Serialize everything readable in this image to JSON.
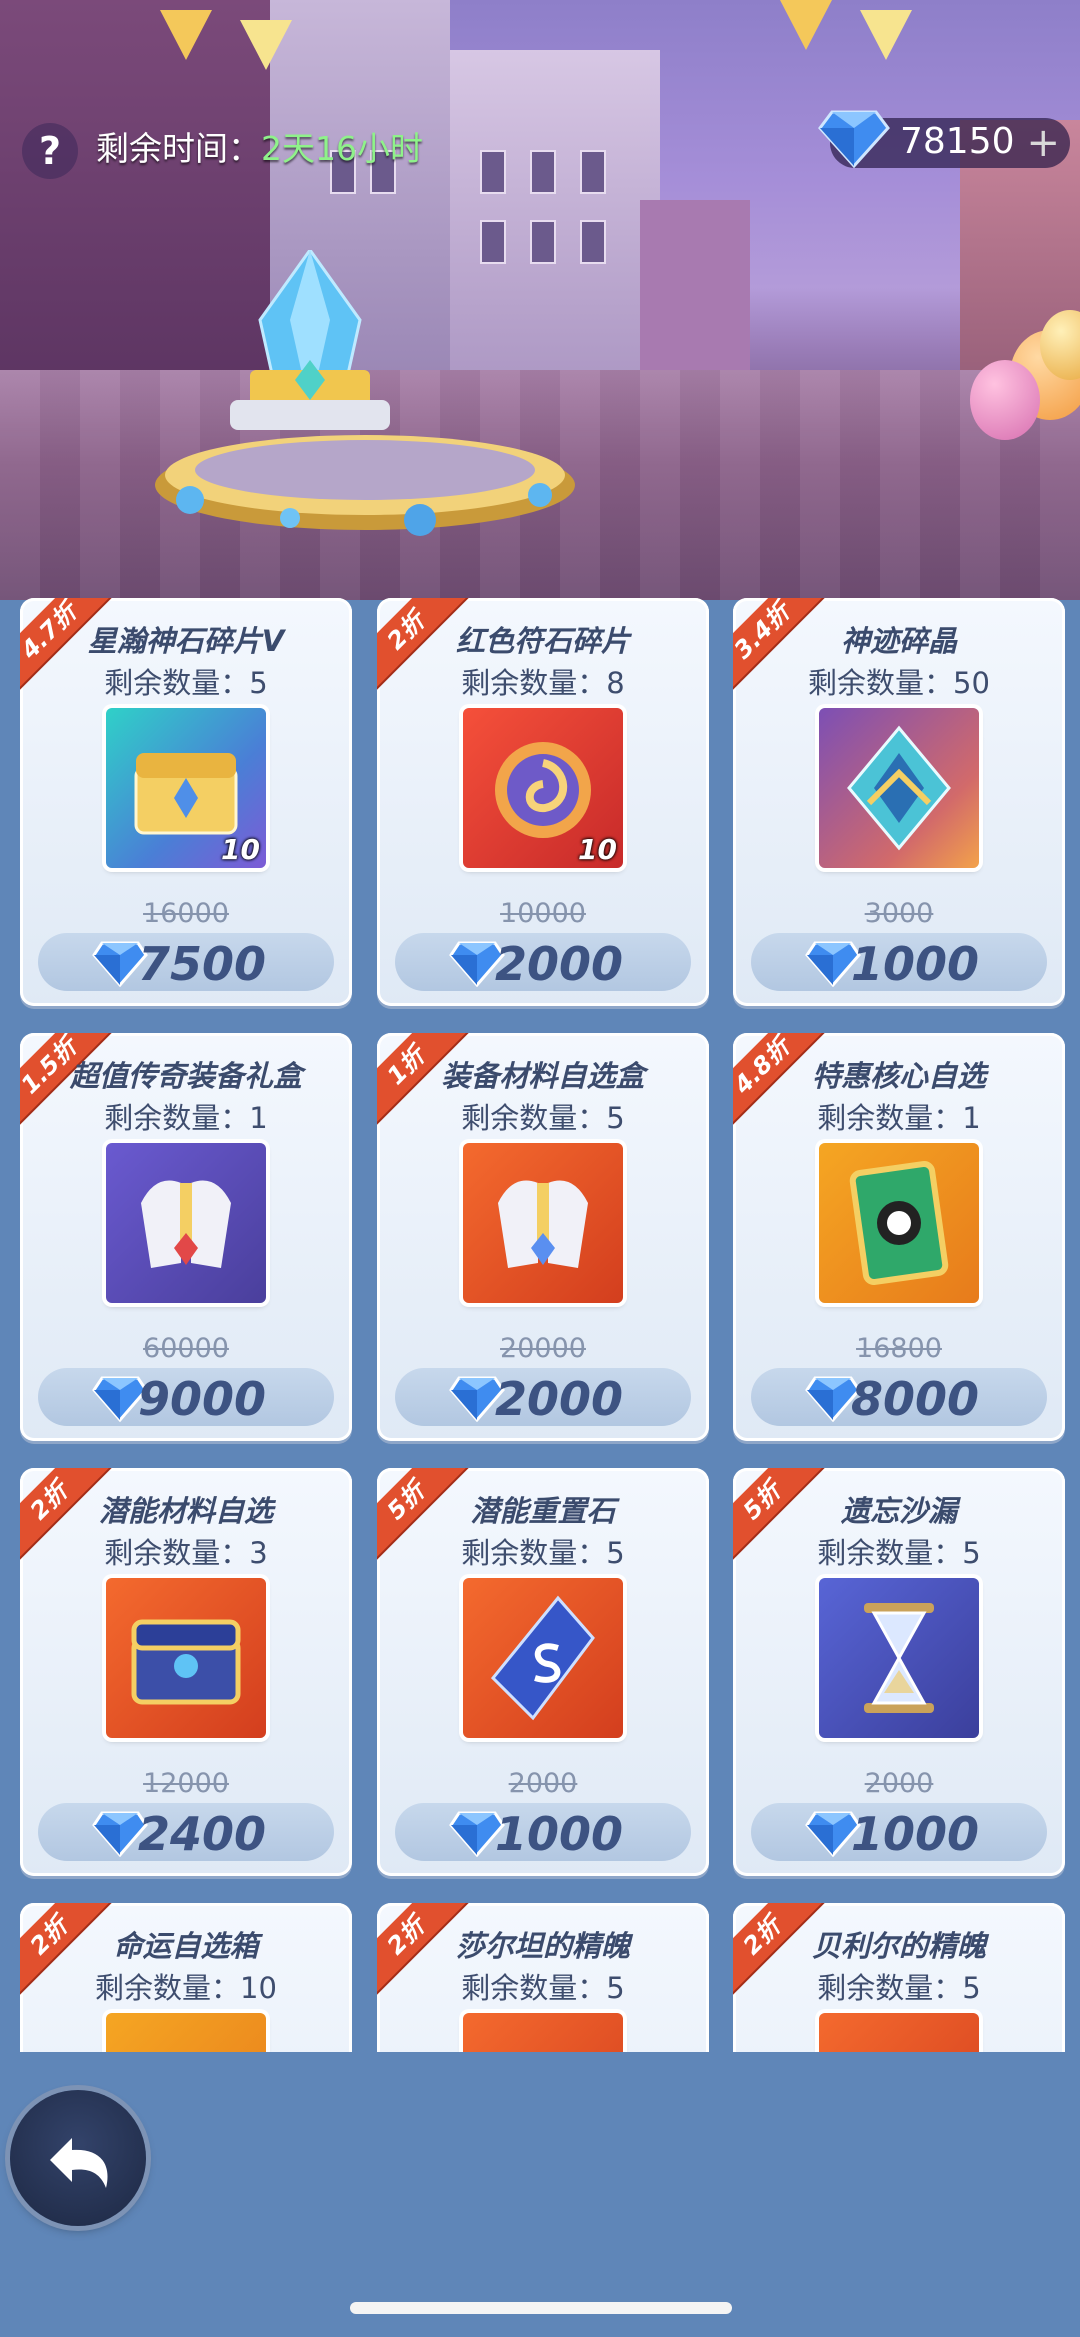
{
  "header": {
    "help_icon": "question-icon",
    "help_label": "?",
    "time_label": "剩余时间：",
    "time_value": "2天16小时",
    "currency_amount": "78150",
    "currency_icon": "diamond-icon",
    "add_icon": "plus-icon",
    "add_label": "+"
  },
  "colors": {
    "discount_tag": "#e1502e",
    "timer_value": "#8ff28a",
    "price_text": "#3d5382",
    "background": "#5f86b8"
  },
  "shop": {
    "items": [
      {
        "discount": "4.7折",
        "name": "星瀚神石碎片V",
        "remaining": "剩余数量：5",
        "original_price": "16000",
        "price": "7500",
        "icon": "golden-chest-icon",
        "count": "10"
      },
      {
        "discount": "2折",
        "name": "红色符石碎片",
        "remaining": "剩余数量：8",
        "original_price": "10000",
        "price": "2000",
        "icon": "red-rune-icon",
        "count": "10"
      },
      {
        "discount": "3.4折",
        "name": "神迹碎晶",
        "remaining": "剩余数量：50",
        "original_price": "3000",
        "price": "1000",
        "icon": "crystal-shard-icon",
        "count": ""
      },
      {
        "discount": "1.5折",
        "name": "超值传奇装备礼盒",
        "remaining": "剩余数量：1",
        "original_price": "60000",
        "price": "9000",
        "icon": "armor-box-icon",
        "count": ""
      },
      {
        "discount": "1折",
        "name": "装备材料自选盒",
        "remaining": "剩余数量：5",
        "original_price": "20000",
        "price": "2000",
        "icon": "armor-box-orange-icon",
        "count": ""
      },
      {
        "discount": "4.8折",
        "name": "特惠核心自选",
        "remaining": "剩余数量：1",
        "original_price": "16800",
        "price": "8000",
        "icon": "core-card-icon",
        "count": ""
      },
      {
        "discount": "2折",
        "name": "潜能材料自选",
        "remaining": "剩余数量：3",
        "original_price": "12000",
        "price": "2400",
        "icon": "blue-chest-icon",
        "count": ""
      },
      {
        "discount": "5折",
        "name": "潜能重置石",
        "remaining": "剩余数量：5",
        "original_price": "2000",
        "price": "1000",
        "icon": "reset-stone-icon",
        "count": ""
      },
      {
        "discount": "5折",
        "name": "遗忘沙漏",
        "remaining": "剩余数量：5",
        "original_price": "2000",
        "price": "1000",
        "icon": "hourglass-icon",
        "count": ""
      },
      {
        "discount": "2折",
        "name": "命运自选箱",
        "remaining": "剩余数量：10",
        "original_price": "",
        "price": "",
        "icon": "fate-box-icon",
        "count": ""
      },
      {
        "discount": "2折",
        "name": "莎尔坦的精魄",
        "remaining": "剩余数量：5",
        "original_price": "",
        "price": "",
        "icon": "spirit-icon",
        "count": ""
      },
      {
        "discount": "2折",
        "name": "贝利尔的精魄",
        "remaining": "剩余数量：5",
        "original_price": "",
        "price": "",
        "icon": "spirit-icon-2",
        "count": ""
      }
    ]
  },
  "footer": {
    "back_icon": "back-arrow-icon"
  }
}
